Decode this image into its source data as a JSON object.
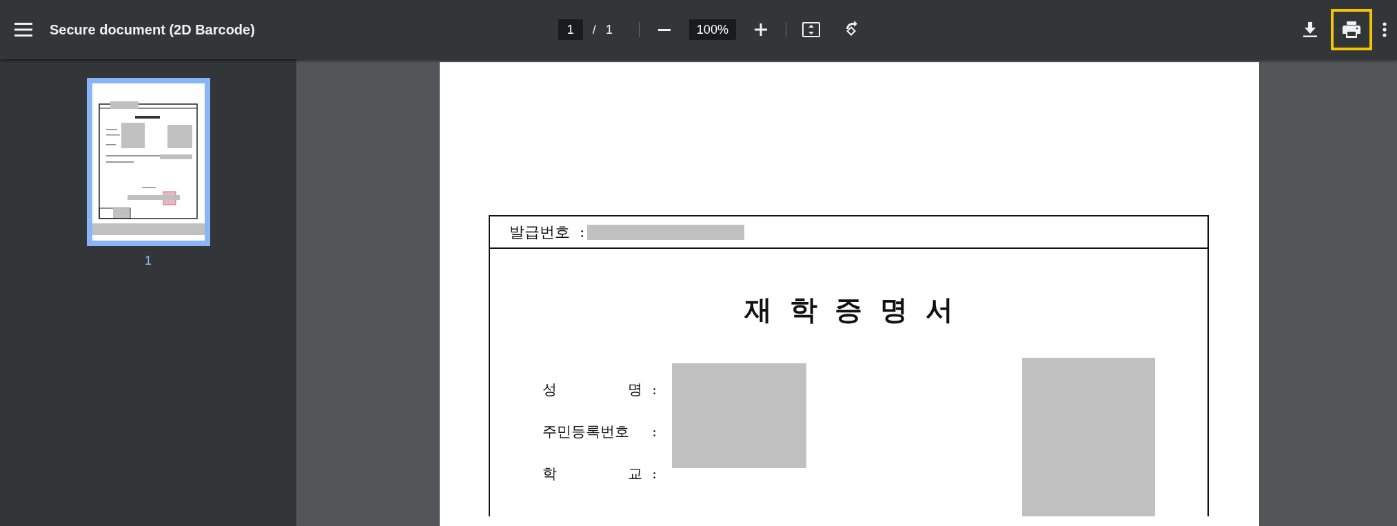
{
  "toolbar": {
    "title": "Secure document (2D Barcode)",
    "page_value": "1",
    "page_separator": "/",
    "page_total": "1",
    "zoom": "100%",
    "actions": [
      {
        "kind": "download",
        "highlighted": false
      },
      {
        "kind": "print",
        "highlighted": true
      }
    ]
  },
  "sidebar": {
    "thumbnails": [
      {
        "label": "1",
        "selected": true
      }
    ]
  },
  "document": {
    "issue_label": "발급번호",
    "issue_colon": ":",
    "heading": "재 학 증 명 서",
    "fields": [
      {
        "label": "성 명",
        "colon": ":"
      },
      {
        "label": "주민등록번호",
        "colon": ":"
      },
      {
        "label": "학 교",
        "colon": ":"
      }
    ]
  }
}
